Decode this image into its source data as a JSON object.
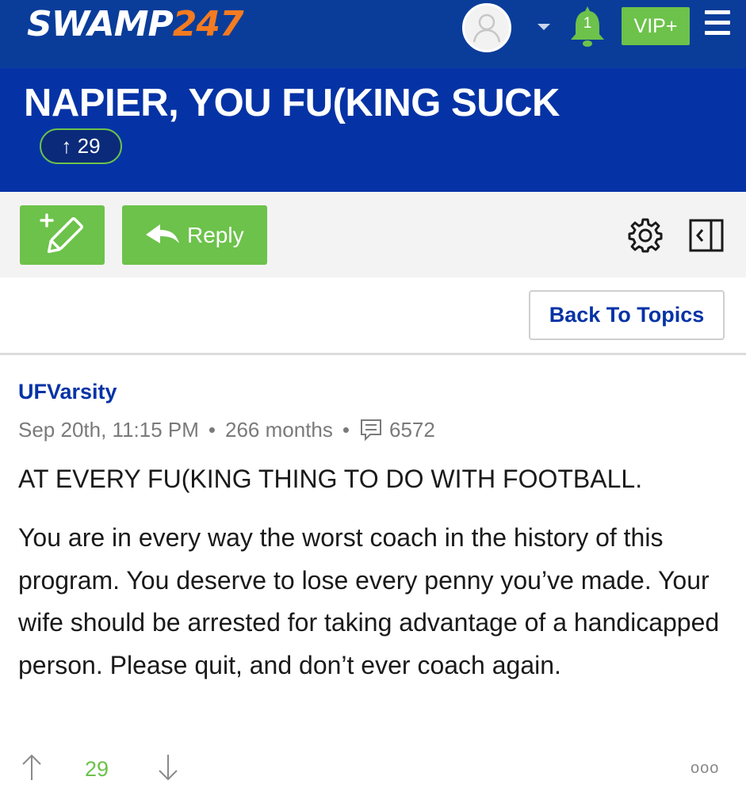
{
  "header": {
    "logo_white": "SWAMP",
    "logo_orange": "247",
    "notification_count": "1",
    "vip_label": "VIP+",
    "accent_color": "#0533a6",
    "brand_green": "#6cc24a",
    "brand_orange": "#f47b20"
  },
  "thread": {
    "title": "NAPIER, YOU FU(KING SUCK",
    "vote_count": "29"
  },
  "toolbar": {
    "reply_label": "Reply",
    "back_label": "Back To Topics"
  },
  "post": {
    "author": "UFVarsity",
    "date": "Sep 20th, 11:15 PM",
    "member_age": "266 months",
    "post_count": "6572",
    "lead": "AT EVERY FU(KING THING TO DO WITH FOOTBALL.",
    "body": "You are in every way the worst coach in the history of this program. You deserve to lose every penny you’ve made. Your wife should be arrested for taking advantage of a handicapped person. Please quit, and don’t ever coach again.",
    "score": "29",
    "more_label": "ooo"
  },
  "icons": [
    "avatar-icon",
    "chevron-down-icon",
    "bell-icon",
    "menu-icon",
    "new-topic-icon",
    "reply-arrow-icon",
    "gear-icon",
    "sidebar-toggle-icon",
    "comment-icon",
    "upvote-icon",
    "downvote-icon"
  ]
}
